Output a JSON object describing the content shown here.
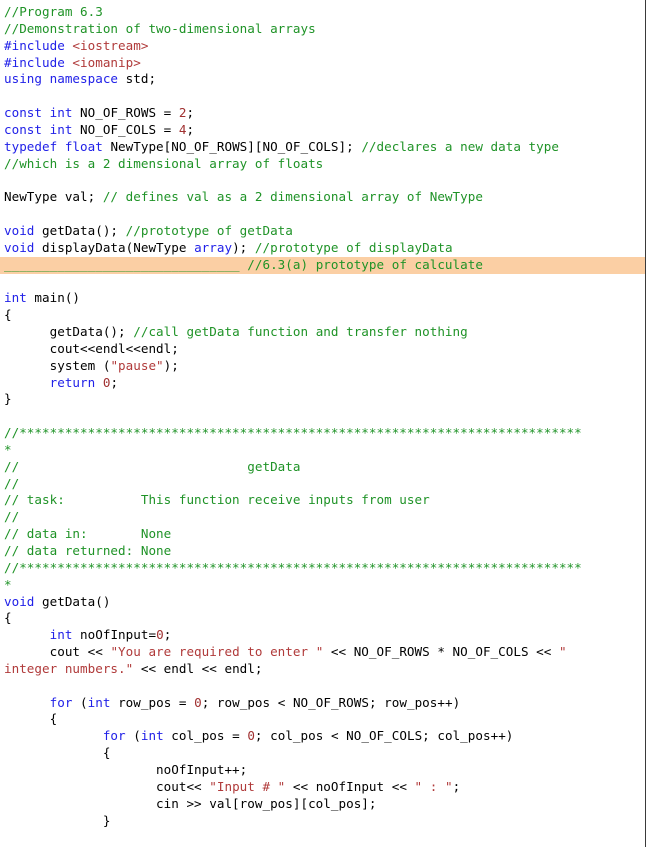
{
  "window": {
    "title": "Program 6.3 — two-dimensional arrays",
    "kind": "code-listing",
    "language": "C++"
  },
  "colors": {
    "background": "#ffffff",
    "comment": "#1f9327",
    "keyword": "#2121e8",
    "string": "#b03a3a",
    "number": "#a03030",
    "plain": "#000000",
    "highlight": "#fbcfa4",
    "right_rule": "#3a3a3a"
  },
  "highlight": {
    "line_number": 16,
    "blank": "_______________________________",
    "note": "//6.3(a) prototype of calculate"
  },
  "code": {
    "lines": [
      {
        "id": 1,
        "text": "//Program 6.3",
        "tokens": [
          {
            "t": "//Program 6.3",
            "c": "c"
          }
        ]
      },
      {
        "id": 2,
        "text": "//Demonstration of two-dimensional arrays",
        "tokens": [
          {
            "t": "//Demonstration of two-dimensional arrays",
            "c": "c"
          }
        ]
      },
      {
        "id": 3,
        "text": "#include <iostream>",
        "tokens": [
          {
            "t": "#include ",
            "c": "k"
          },
          {
            "t": "<iostream>",
            "c": "s"
          }
        ]
      },
      {
        "id": 4,
        "text": "#include <iomanip>",
        "tokens": [
          {
            "t": "#include ",
            "c": "k"
          },
          {
            "t": "<iomanip>",
            "c": "s"
          }
        ]
      },
      {
        "id": 5,
        "text": "using namespace std;",
        "tokens": [
          {
            "t": "using namespace ",
            "c": "k"
          },
          {
            "t": "std;",
            "c": "p"
          }
        ]
      },
      {
        "id": 6,
        "text": "",
        "tokens": []
      },
      {
        "id": 7,
        "text": "const int NO_OF_ROWS = 2;",
        "tokens": [
          {
            "t": "const int ",
            "c": "k"
          },
          {
            "t": "NO_OF_ROWS = ",
            "c": "p"
          },
          {
            "t": "2",
            "c": "n"
          },
          {
            "t": ";",
            "c": "p"
          }
        ]
      },
      {
        "id": 8,
        "text": "const int NO_OF_COLS = 4;",
        "tokens": [
          {
            "t": "const int ",
            "c": "k"
          },
          {
            "t": "NO_OF_COLS = ",
            "c": "p"
          },
          {
            "t": "4",
            "c": "n"
          },
          {
            "t": ";",
            "c": "p"
          }
        ]
      },
      {
        "id": 9,
        "text": "typedef float NewType[NO_OF_ROWS][NO_OF_COLS]; //declares a new data type",
        "tokens": [
          {
            "t": "typedef float ",
            "c": "k"
          },
          {
            "t": "NewType[NO_OF_ROWS][NO_OF_COLS]; ",
            "c": "p"
          },
          {
            "t": "//declares a new data type",
            "c": "c"
          }
        ]
      },
      {
        "id": 10,
        "text": "//which is a 2 dimensional array of floats",
        "tokens": [
          {
            "t": "//which is a 2 dimensional array of floats",
            "c": "c"
          }
        ]
      },
      {
        "id": 11,
        "text": "",
        "tokens": []
      },
      {
        "id": 12,
        "text": "NewType val; // defines val as a 2 dimensional array of NewType",
        "tokens": [
          {
            "t": "NewType val; ",
            "c": "p"
          },
          {
            "t": "// defines val as a 2 dimensional array of NewType",
            "c": "c"
          }
        ]
      },
      {
        "id": 13,
        "text": "",
        "tokens": []
      },
      {
        "id": 14,
        "text": "void getData(); //prototype of getData",
        "tokens": [
          {
            "t": "void ",
            "c": "k"
          },
          {
            "t": "getData(); ",
            "c": "p"
          },
          {
            "t": "//prototype of getData",
            "c": "c"
          }
        ]
      },
      {
        "id": 15,
        "text": "void displayData(NewType array); //prototype of displayData",
        "tokens": [
          {
            "t": "void ",
            "c": "k"
          },
          {
            "t": "displayData(NewType ",
            "c": "p"
          },
          {
            "t": "array",
            "c": "k"
          },
          {
            "t": "); ",
            "c": "p"
          },
          {
            "t": "//prototype of displayData",
            "c": "c"
          }
        ]
      },
      {
        "id": 16,
        "text": "_______________________________ //6.3(a) prototype of calculate",
        "highlight": true,
        "tokens": [
          {
            "t": "_______________________________",
            "c": "u"
          },
          {
            "t": " //6.3(a) prototype of calculate",
            "c": "c"
          }
        ]
      },
      {
        "id": 17,
        "text": "",
        "tokens": []
      },
      {
        "id": 18,
        "text": "int main()",
        "tokens": [
          {
            "t": "int ",
            "c": "k"
          },
          {
            "t": "main()",
            "c": "p"
          }
        ]
      },
      {
        "id": 19,
        "text": "{",
        "tokens": [
          {
            "t": "{",
            "c": "p"
          }
        ]
      },
      {
        "id": 20,
        "text": "      getData(); //call getData function and transfer nothing",
        "tokens": [
          {
            "t": "      getData(); ",
            "c": "p"
          },
          {
            "t": "//call getData function and transfer nothing",
            "c": "c"
          }
        ]
      },
      {
        "id": 21,
        "text": "      cout<<endl<<endl;",
        "tokens": [
          {
            "t": "      cout<<endl<<endl;",
            "c": "p"
          }
        ]
      },
      {
        "id": 22,
        "text": "      system (\"pause\");",
        "tokens": [
          {
            "t": "      system (",
            "c": "p"
          },
          {
            "t": "\"pause\"",
            "c": "s"
          },
          {
            "t": ");",
            "c": "p"
          }
        ]
      },
      {
        "id": 23,
        "text": "      return 0;",
        "tokens": [
          {
            "t": "      ",
            "c": "p"
          },
          {
            "t": "return ",
            "c": "k"
          },
          {
            "t": "0",
            "c": "n"
          },
          {
            "t": ";",
            "c": "p"
          }
        ]
      },
      {
        "id": 24,
        "text": "}",
        "tokens": [
          {
            "t": "}",
            "c": "p"
          }
        ]
      },
      {
        "id": 25,
        "text": "",
        "tokens": []
      },
      {
        "id": 26,
        "text": "//**************************************************************************",
        "tokens": [
          {
            "t": "//**************************************************************************",
            "c": "c"
          }
        ]
      },
      {
        "id": 27,
        "text": "*",
        "tokens": [
          {
            "t": "*",
            "c": "c"
          }
        ]
      },
      {
        "id": 28,
        "text": "//                              getData",
        "tokens": [
          {
            "t": "//                              getData",
            "c": "c"
          }
        ]
      },
      {
        "id": 29,
        "text": "//",
        "tokens": [
          {
            "t": "//",
            "c": "c"
          }
        ]
      },
      {
        "id": 30,
        "text": "// task:          This function receive inputs from user",
        "tokens": [
          {
            "t": "// task:          This function receive inputs from user",
            "c": "c"
          }
        ]
      },
      {
        "id": 31,
        "text": "//",
        "tokens": [
          {
            "t": "//",
            "c": "c"
          }
        ]
      },
      {
        "id": 32,
        "text": "// data in:       None",
        "tokens": [
          {
            "t": "// data in:       None",
            "c": "c"
          }
        ]
      },
      {
        "id": 33,
        "text": "// data returned: None",
        "tokens": [
          {
            "t": "// data returned: None",
            "c": "c"
          }
        ]
      },
      {
        "id": 34,
        "text": "//**************************************************************************",
        "tokens": [
          {
            "t": "//**************************************************************************",
            "c": "c"
          }
        ]
      },
      {
        "id": 35,
        "text": "*",
        "tokens": [
          {
            "t": "*",
            "c": "c"
          }
        ]
      },
      {
        "id": 36,
        "text": "void getData()",
        "tokens": [
          {
            "t": "void ",
            "c": "k"
          },
          {
            "t": "getData()",
            "c": "p"
          }
        ]
      },
      {
        "id": 37,
        "text": "{",
        "tokens": [
          {
            "t": "{",
            "c": "p"
          }
        ]
      },
      {
        "id": 38,
        "text": "      int noOfInput=0;",
        "tokens": [
          {
            "t": "      ",
            "c": "p"
          },
          {
            "t": "int ",
            "c": "k"
          },
          {
            "t": "noOfInput=",
            "c": "p"
          },
          {
            "t": "0",
            "c": "n"
          },
          {
            "t": ";",
            "c": "p"
          }
        ]
      },
      {
        "id": 39,
        "text": "      cout << \"You are required to enter \" << NO_OF_ROWS * NO_OF_COLS << \"",
        "tokens": [
          {
            "t": "      cout << ",
            "c": "p"
          },
          {
            "t": "\"You are required to enter \"",
            "c": "s"
          },
          {
            "t": " << NO_OF_ROWS * NO_OF_COLS << ",
            "c": "p"
          },
          {
            "t": "\"",
            "c": "s"
          }
        ]
      },
      {
        "id": 40,
        "text": "integer numbers.\" << endl << endl;",
        "tokens": [
          {
            "t": "integer numbers.\"",
            "c": "s"
          },
          {
            "t": " << endl << endl;",
            "c": "p"
          }
        ]
      },
      {
        "id": 41,
        "text": "",
        "tokens": []
      },
      {
        "id": 42,
        "text": "      for (int row_pos = 0; row_pos < NO_OF_ROWS; row_pos++)",
        "tokens": [
          {
            "t": "      ",
            "c": "p"
          },
          {
            "t": "for ",
            "c": "k"
          },
          {
            "t": "(",
            "c": "p"
          },
          {
            "t": "int ",
            "c": "k"
          },
          {
            "t": "row_pos = ",
            "c": "p"
          },
          {
            "t": "0",
            "c": "n"
          },
          {
            "t": "; row_pos < NO_OF_ROWS; row_pos++)",
            "c": "p"
          }
        ]
      },
      {
        "id": 43,
        "text": "      {",
        "tokens": [
          {
            "t": "      {",
            "c": "p"
          }
        ]
      },
      {
        "id": 44,
        "text": "             for (int col_pos = 0; col_pos < NO_OF_COLS; col_pos++)",
        "tokens": [
          {
            "t": "             ",
            "c": "p"
          },
          {
            "t": "for ",
            "c": "k"
          },
          {
            "t": "(",
            "c": "p"
          },
          {
            "t": "int ",
            "c": "k"
          },
          {
            "t": "col_pos = ",
            "c": "p"
          },
          {
            "t": "0",
            "c": "n"
          },
          {
            "t": "; col_pos < NO_OF_COLS; col_pos++)",
            "c": "p"
          }
        ]
      },
      {
        "id": 45,
        "text": "             {",
        "tokens": [
          {
            "t": "             {",
            "c": "p"
          }
        ]
      },
      {
        "id": 46,
        "text": "                    noOfInput++;",
        "tokens": [
          {
            "t": "                    noOfInput++;",
            "c": "p"
          }
        ]
      },
      {
        "id": 47,
        "text": "                    cout<< \"Input # \" << noOfInput << \" : \";",
        "tokens": [
          {
            "t": "                    cout<< ",
            "c": "p"
          },
          {
            "t": "\"Input # \"",
            "c": "s"
          },
          {
            "t": " << noOfInput << ",
            "c": "p"
          },
          {
            "t": "\" : \"",
            "c": "s"
          },
          {
            "t": ";",
            "c": "p"
          }
        ]
      },
      {
        "id": 48,
        "text": "                    cin >> val[row_pos][col_pos];",
        "tokens": [
          {
            "t": "                    cin >> val[row_pos][col_pos];",
            "c": "p"
          }
        ]
      },
      {
        "id": 49,
        "text": "             }",
        "tokens": [
          {
            "t": "             }",
            "c": "p"
          }
        ]
      }
    ]
  }
}
